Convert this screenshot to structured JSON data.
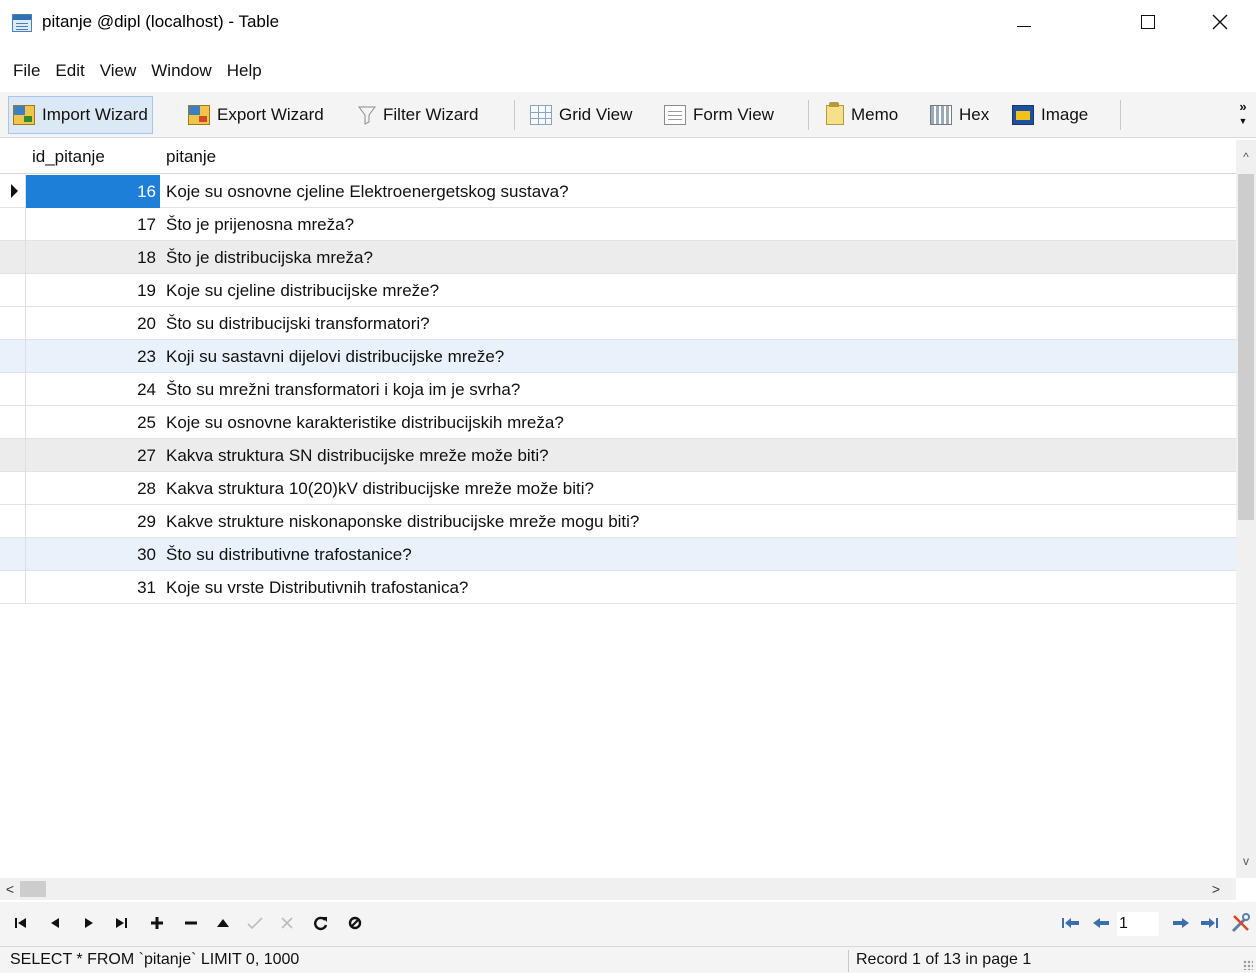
{
  "window": {
    "title": "pitanje @dipl (localhost) - Table",
    "controls": {
      "minimize": "—",
      "maximize": "☐",
      "close": "✕"
    }
  },
  "menu": [
    "File",
    "Edit",
    "View",
    "Window",
    "Help"
  ],
  "toolbar": {
    "import_wizard": "Import Wizard",
    "export_wizard": "Export Wizard",
    "filter_wizard": "Filter Wizard",
    "grid_view": "Grid View",
    "form_view": "Form View",
    "memo": "Memo",
    "hex": "Hex",
    "image": "Image",
    "overflow": "»"
  },
  "grid": {
    "columns": [
      "id_pitanje",
      "pitanje"
    ],
    "rows": [
      {
        "id": "16",
        "pitanje": "Koje su osnovne cjeline Elektroenergetskog sustava?"
      },
      {
        "id": "17",
        "pitanje": "Što je prijenosna mreža?"
      },
      {
        "id": "18",
        "pitanje": "Što je distribucijska mreža?"
      },
      {
        "id": "19",
        "pitanje": "Koje su cjeline distribucijske mreže?"
      },
      {
        "id": "20",
        "pitanje": "Što su distribucijski transformatori?"
      },
      {
        "id": "23",
        "pitanje": "Koji su sastavni dijelovi distribucijske mreže?"
      },
      {
        "id": "24",
        "pitanje": "Što su mrežni transformatori i koja im je svrha?"
      },
      {
        "id": "25",
        "pitanje": "Koje su osnovne karakteristike distribucijskih mreža?"
      },
      {
        "id": "27",
        "pitanje": "Kakva struktura SN distribucijske mreže može biti?"
      },
      {
        "id": "28",
        "pitanje": "Kakva struktura 10(20)kV distribucijske mreže može biti?"
      },
      {
        "id": "29",
        "pitanje": "Kakve strukture niskonaponske distribucijske mreže mogu biti?"
      },
      {
        "id": "30",
        "pitanje": "Što su distributivne trafostanice?"
      },
      {
        "id": "31",
        "pitanje": "Koje su vrste Distributivnih trafostanica?"
      }
    ],
    "selected_row": 0
  },
  "navigation": {
    "page": "1"
  },
  "status": {
    "query": "SELECT * FROM `pitanje` LIMIT 0, 1000",
    "record": "Record 1 of 13 in page 1"
  },
  "colors": {
    "selection": "#1e7fd8",
    "toolbar_bg": "#f4f4f4"
  }
}
